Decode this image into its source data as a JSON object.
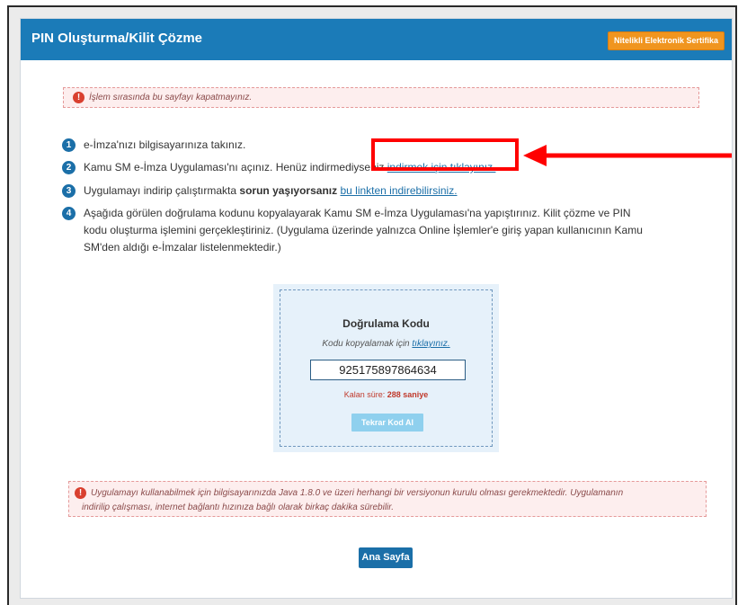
{
  "header": {
    "title": "PIN Oluşturma/Kilit Çözme",
    "cert_button": "Nitelikli Elektronik Sertifika"
  },
  "alert_top": "İşlem sırasında bu sayfayı kapatmayınız.",
  "steps": [
    {
      "num": "1",
      "text": "e-İmza'nızı bilgisayarınıza takınız."
    },
    {
      "num": "2",
      "text": "Kamu SM e-İmza Uygulaması'nı açınız. Henüz indirmediyseniz",
      "link": "indirmek için tıklayınız."
    },
    {
      "num": "3",
      "text": "Uygulamayı indirip çalıştırmakta",
      "bold": "sorun yaşıyorsanız",
      "link": "bu linkten indirebilirsiniz."
    },
    {
      "num": "4",
      "line1": "Aşağıda görülen doğrulama kodunu kopyalayarak Kamu SM e-İmza Uygulaması'na yapıştırınız. Kilit çözme ve PIN",
      "line2": "kodu oluşturma işlemini gerçekleştiriniz. (Uygulama üzerinde yalnızca Online İşlemler'e giriş yapan kullanıcının Kamu",
      "line3": "SM'den aldığı e-İmzalar listelenmektedir.)"
    }
  ],
  "verify": {
    "title": "Doğrulama Kodu",
    "copy_prefix": "Kodu kopyalamak için",
    "copy_link": "tıklayınız.",
    "code": "925175897864634",
    "remaining_label": "Kalan süre:",
    "remaining_value": "288",
    "remaining_unit": "saniye",
    "new_code_button": "Tekrar Kod Al"
  },
  "alert_bottom": {
    "line1": "Uygulamayı kullanabilmek için bilgisayarınızda Java 1.8.0 ve üzeri herhangi bir versiyonun kurulu olması gerekmektedir. Uygulamanın",
    "line2": "indirilip çalışması, internet bağlantı hızınıza bağlı olarak birkaç dakika sürebilir."
  },
  "home_button": "Ana Sayfa",
  "colors": {
    "header": "#1b7bb8",
    "accent_orange": "#f0951f",
    "highlight_red": "#ff0000"
  }
}
